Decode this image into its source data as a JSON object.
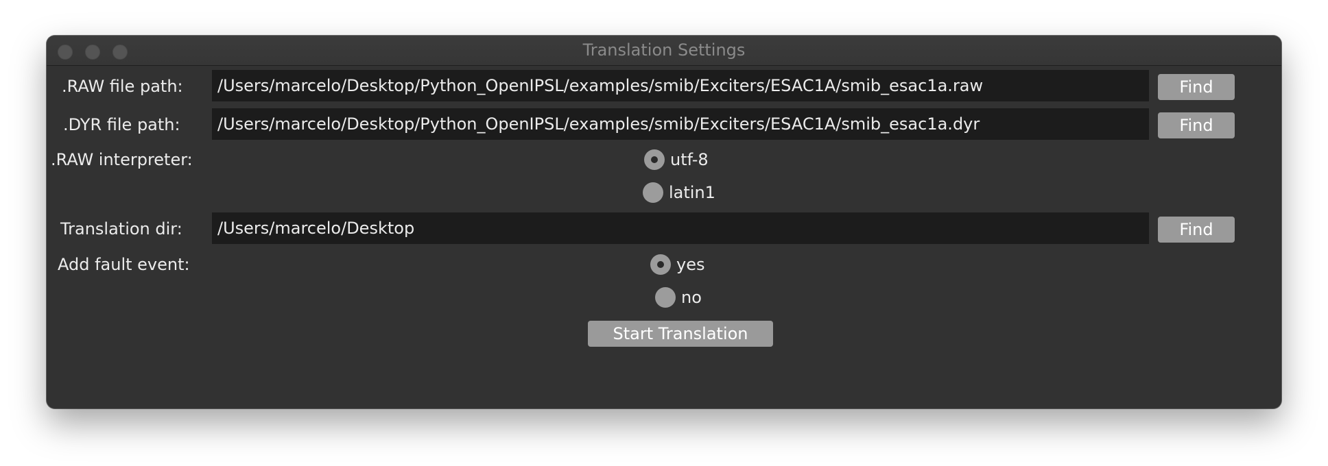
{
  "window": {
    "title": "Translation Settings"
  },
  "raw_file": {
    "label": ".RAW file path:",
    "value": "/Users/marcelo/Desktop/Python_OpenIPSL/examples/smib/Exciters/ESAC1A/smib_esac1a.raw",
    "find_label": "Find"
  },
  "dyr_file": {
    "label": ".DYR file path:",
    "value": "/Users/marcelo/Desktop/Python_OpenIPSL/examples/smib/Exciters/ESAC1A/smib_esac1a.dyr",
    "find_label": "Find"
  },
  "raw_interpreter": {
    "label": ".RAW interpreter:",
    "options": [
      "utf-8",
      "latin1"
    ],
    "selected": "utf-8"
  },
  "translation_dir": {
    "label": "Translation dir:",
    "value": "/Users/marcelo/Desktop",
    "find_label": "Find"
  },
  "fault_event": {
    "label": "Add fault event:",
    "options": [
      "yes",
      "no"
    ],
    "selected": "yes"
  },
  "start_button": {
    "label": "Start Translation"
  },
  "colors": {
    "window_bg": "#323232",
    "field_bg": "#1c1c1c",
    "button_bg": "#9a9a9a",
    "text": "#ececec"
  }
}
